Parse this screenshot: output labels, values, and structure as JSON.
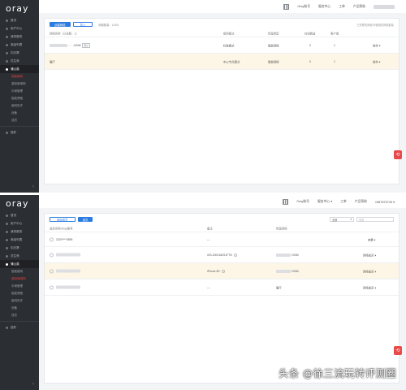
{
  "logo": "oray",
  "top": {
    "sidebar": {
      "items": [
        "首页",
        "用户中心",
        "我的服务",
        "商品列表",
        "向日葵",
        "花生壳"
      ],
      "active": "蒲公英",
      "subitems": [
        "智能组网",
        "虚拟局域网",
        "中继管理",
        "智能旁路",
        "组网历史",
        "设备",
        "成员"
      ],
      "bottom_item": "插件"
    },
    "header": {
      "items": [
        "Oray账号",
        "服务中心",
        "工单",
        "产品帮助"
      ]
    },
    "toolbar": {
      "primary": "创建网络",
      "secondary": "导入",
      "stat": "网络数量：1/100",
      "note": "已关联的网络/可使用的网络数量"
    },
    "table": {
      "headers": [
        "网络名称（已关联：1）",
        "组网模式",
        "所属类型",
        "在线数量",
        "客户端",
        ""
      ],
      "rows": [
        {
          "name": "……OSIM",
          "tag": "默认",
          "mode": "标准模式",
          "type": "智能网络",
          "online": "0",
          "clients": "1",
          "action": "操作 ▾"
        },
        {
          "name": "展厅",
          "mode": "中心节点模式",
          "type": "智能网络",
          "online": "0",
          "clients": "1",
          "action": "操作 ▾"
        }
      ]
    }
  },
  "bottom": {
    "header": {
      "items": [
        "Oray账号",
        "服务中心 ▾",
        "工单",
        "产品帮助",
        "1587879743 ▾"
      ]
    },
    "sidebar": {
      "items": [
        "首页",
        "用户中心",
        "我的服务",
        "商品列表",
        "向日葵",
        "花生壳"
      ],
      "active": "蒲公英",
      "subitems": [
        "智能组网",
        "虚拟局域网",
        "中继管理",
        "智能旁路",
        "组网历史",
        "设备",
        "成员"
      ],
      "bottom_item": "插件"
    },
    "toolbar": {
      "tab1": "组网成员",
      "tab2": "成员",
      "select": "全部",
      "search_placeholder": "搜索"
    },
    "table": {
      "headers": [
        "成员名称/Oray账号",
        "备注",
        "所属网络",
        ""
      ],
      "rows": [
        {
          "name": "3220****0895",
          "note": "—",
          "network": "",
          "action": "查看 ▾"
        },
        {
          "name": "",
          "note": "iOS-2000182S1FTN",
          "network": "OSIM",
          "action": "网络成员 ▾"
        },
        {
          "name": "",
          "note": "iPhone 8S",
          "network": "OSIM",
          "action": "网络成员 ▾"
        },
        {
          "name": "",
          "note": "—",
          "network": "展厅",
          "action": "网络成员 ▾"
        }
      ]
    }
  },
  "watermark": "头条 @徐三流玩转评测圈",
  "colors": {
    "sidebar": "#2b2e33",
    "primary": "#2a7ce0",
    "highlight": "#fdf6e6",
    "float": "#e84a4a"
  }
}
